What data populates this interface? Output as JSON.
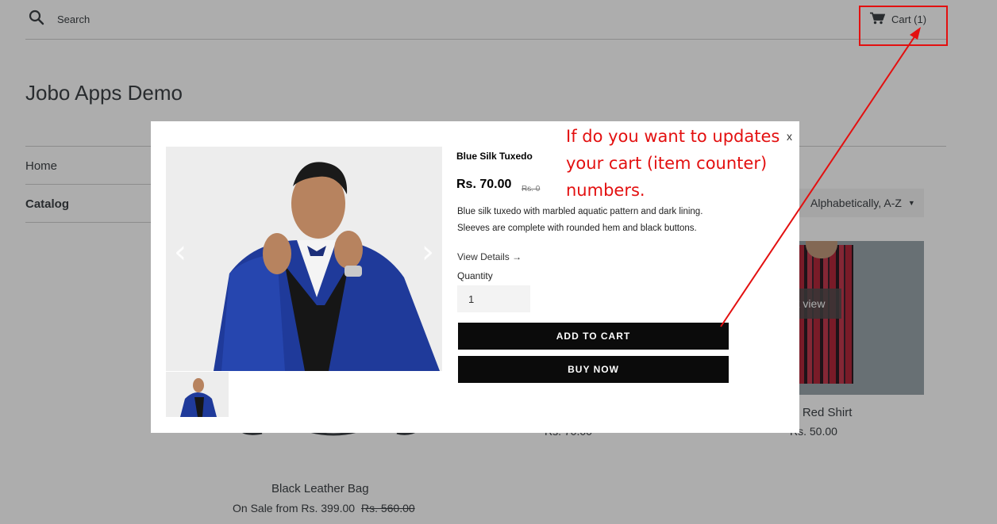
{
  "header": {
    "search_label": "Search",
    "cart_label": "Cart (1)"
  },
  "site": {
    "title": "Jobo Apps Demo"
  },
  "nav": {
    "home": "Home",
    "catalog": "Catalog"
  },
  "collection": {
    "sort_selected": "Alphabetically, A-Z",
    "products": [
      {
        "name": "Black Leather Bag",
        "price": "On Sale from Rs. 399.00",
        "compare_price": "Rs. 560.00"
      },
      {
        "name_partial": "red Red Shirt",
        "price_partial": "Rs. 50.00",
        "quick_view_partial": "k view"
      },
      {
        "price_partial": "Rs. 70.00"
      }
    ]
  },
  "modal": {
    "close_label": "x",
    "product_title": "Blue Silk Tuxedo",
    "price": "Rs. 70.00",
    "compare_price": "Rs. 0",
    "description_line1": "Blue silk tuxedo with marbled aquatic pattern and dark lining.",
    "description_line2": "Sleeves are complete with rounded hem and black buttons.",
    "view_details": "View Details →",
    "quantity_label": "Quantity",
    "quantity_value": "1",
    "add_to_cart": "ADD TO CART",
    "buy_now": "BUY NOW"
  },
  "annotation": {
    "line1": "If do you want to updates",
    "line2": "your cart (item counter)",
    "line3": "numbers.",
    "color": "#e31010"
  },
  "icons": [
    "search-icon",
    "cart-icon",
    "chevron-left-icon",
    "chevron-right-icon",
    "caret-down-icon",
    "arrow-right-icon"
  ]
}
